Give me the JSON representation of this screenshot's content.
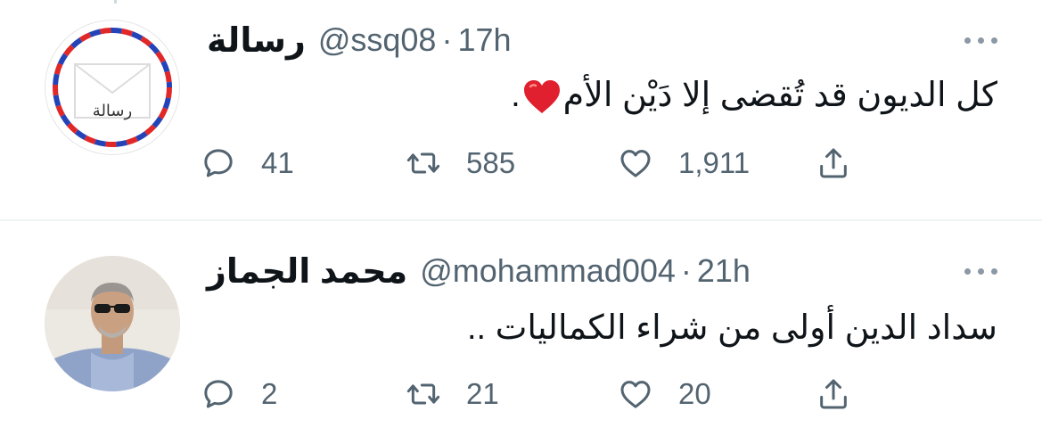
{
  "tweets": [
    {
      "name": "رسالة",
      "handle": "@ssq08",
      "time": "17h",
      "avatar_text": "رسالة",
      "text": "كل الديون قد تُقضى إلا دَيْن الأم",
      "text_suffix": ".",
      "emoji": "red-heart",
      "replies": "41",
      "retweets": "585",
      "likes": "1,911"
    },
    {
      "name": "محمد الجماز",
      "handle": "@mohammad004",
      "time": "21h",
      "text": "سداد الدين أولى من شراء الكماليات ..",
      "replies": "2",
      "retweets": "21",
      "likes": "20"
    }
  ],
  "separator": "·",
  "icons": {
    "reply": "reply-icon",
    "retweet": "retweet-icon",
    "like": "like-icon",
    "share": "share-icon",
    "more": "more-icon"
  },
  "colors": {
    "muted": "#536471",
    "text": "#0f1419",
    "divider": "#eff3f4",
    "emoji_heart": "#e0202e"
  }
}
